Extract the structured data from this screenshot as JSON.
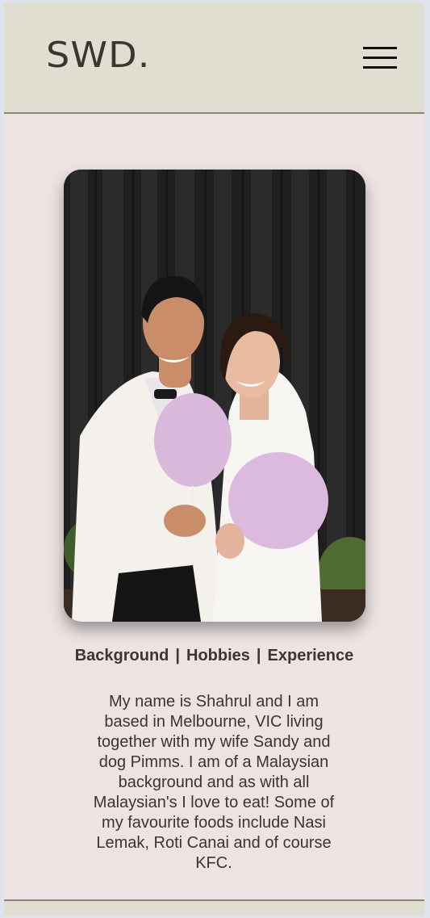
{
  "header": {
    "logo": "SWD.",
    "menu_icon": "hamburger-menu-icon"
  },
  "photo": {
    "alt": "Couple wedding photo holding cotton candy"
  },
  "tabs": [
    {
      "label": "Background"
    },
    {
      "label": "Hobbies"
    },
    {
      "label": "Experience"
    }
  ],
  "separator": "|",
  "bio": "My name is Shahrul and I am based in Melbourne, VIC living together with my wife Sandy and dog Pimms. I am of a Malaysian background and as with all Malaysian's I love to eat! Some of my favourite foods include Nasi Lemak, Roti Canai and of course KFC.",
  "colors": {
    "header_bg": "#e0ded0",
    "page_bg": "#ede3e3",
    "text": "#3a3530"
  }
}
